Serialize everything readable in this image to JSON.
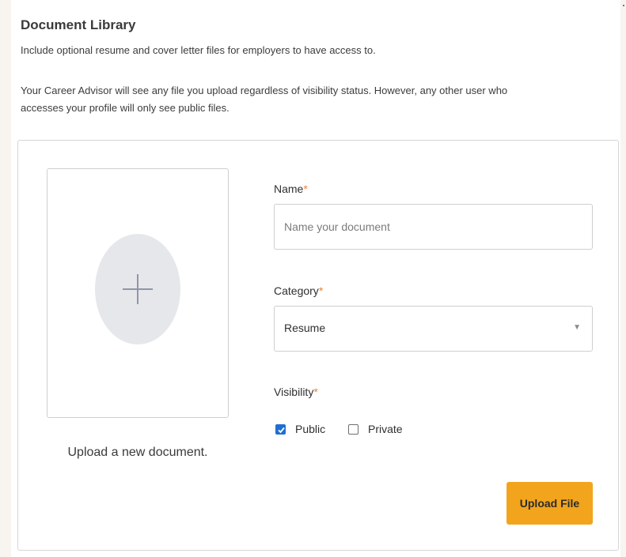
{
  "header": {
    "title": "Document Library",
    "intro": "Include optional resume and cover letter files for employers to have access to.",
    "note": "Your Career Advisor will see any file you upload regardless of visibility status. However, any other user who accesses your profile will only see public files."
  },
  "upload": {
    "label": "Upload a new document.",
    "icon": "plus-icon"
  },
  "form": {
    "name_label": "Name",
    "name_placeholder": "Name your document",
    "name_value": "",
    "category_label": "Category",
    "category_value": "Resume",
    "visibility_label": "Visibility",
    "required_mark": "*",
    "visibility_options": [
      {
        "label": "Public",
        "checked": true
      },
      {
        "label": "Private",
        "checked": false
      }
    ],
    "submit_label": "Upload File"
  },
  "colors": {
    "accent_button": "#f2a51c",
    "checkbox_checked": "#1f6fd1",
    "required_asterisk": "#e8833a",
    "plus_circle": "#e6e7eb"
  }
}
